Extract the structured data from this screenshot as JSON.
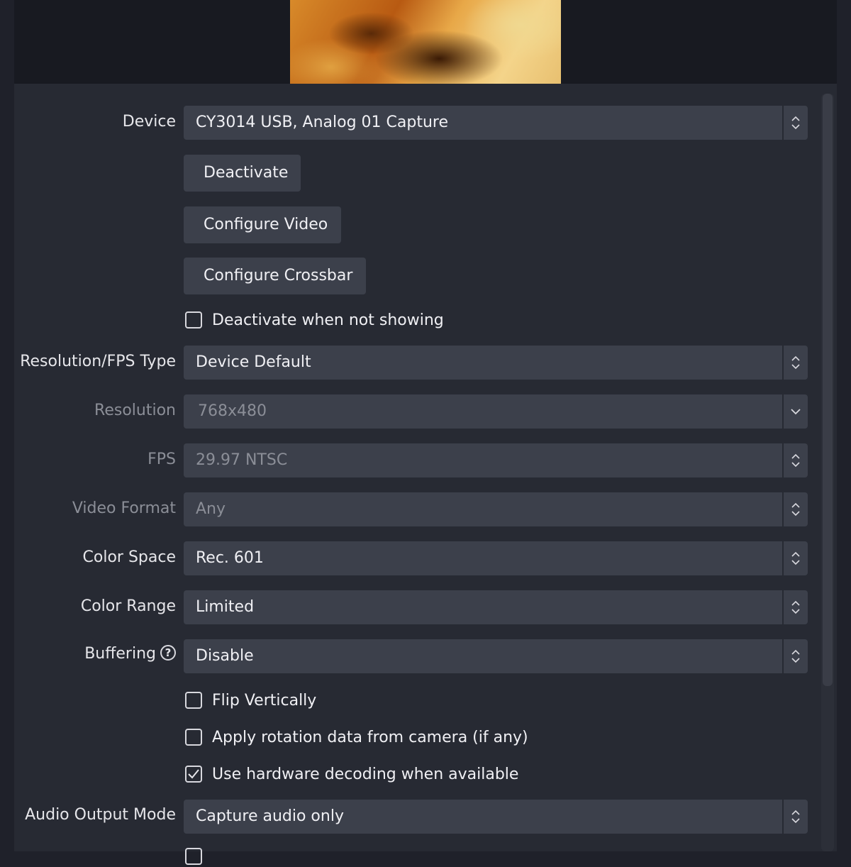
{
  "preview": {
    "kind": "video-capture-preview"
  },
  "fields": {
    "device": {
      "label": "Device",
      "value": "CY3014 USB, Analog 01 Capture",
      "arrow": "updown"
    },
    "resolution_fps_type": {
      "label": "Resolution/FPS Type",
      "value": "Device Default",
      "arrow": "updown"
    },
    "resolution": {
      "label": "Resolution",
      "value": "768x480",
      "arrow": "down",
      "disabled": true
    },
    "fps": {
      "label": "FPS",
      "value": "29.97 NTSC",
      "arrow": "updown",
      "disabled": true
    },
    "video_format": {
      "label": "Video Format",
      "value": "Any",
      "arrow": "updown",
      "disabled": true
    },
    "color_space": {
      "label": "Color Space",
      "value": "Rec. 601",
      "arrow": "updown"
    },
    "color_range": {
      "label": "Color Range",
      "value": "Limited",
      "arrow": "updown"
    },
    "buffering": {
      "label": "Buffering",
      "value": "Disable",
      "arrow": "updown",
      "help_icon": "question-circle-icon"
    },
    "audio_output_mode": {
      "label": "Audio Output Mode",
      "value": "Capture audio only",
      "arrow": "updown"
    }
  },
  "buttons": {
    "deactivate": "Deactivate",
    "configure_video": "Configure Video",
    "configure_crossbar": "Configure Crossbar"
  },
  "checkboxes": {
    "deactivate_when_not_showing": {
      "label": "Deactivate when not showing",
      "checked": false
    },
    "flip_vertically": {
      "label": "Flip Vertically",
      "checked": false
    },
    "apply_rotation": {
      "label": "Apply rotation data from camera (if any)",
      "checked": false
    },
    "hardware_decoding": {
      "label": "Use hardware decoding when available",
      "checked": true
    }
  },
  "colors": {
    "background": "#272a33",
    "control": "#3c404b",
    "text": "#f0f0f4",
    "disabled_text": "#8b8e97"
  }
}
